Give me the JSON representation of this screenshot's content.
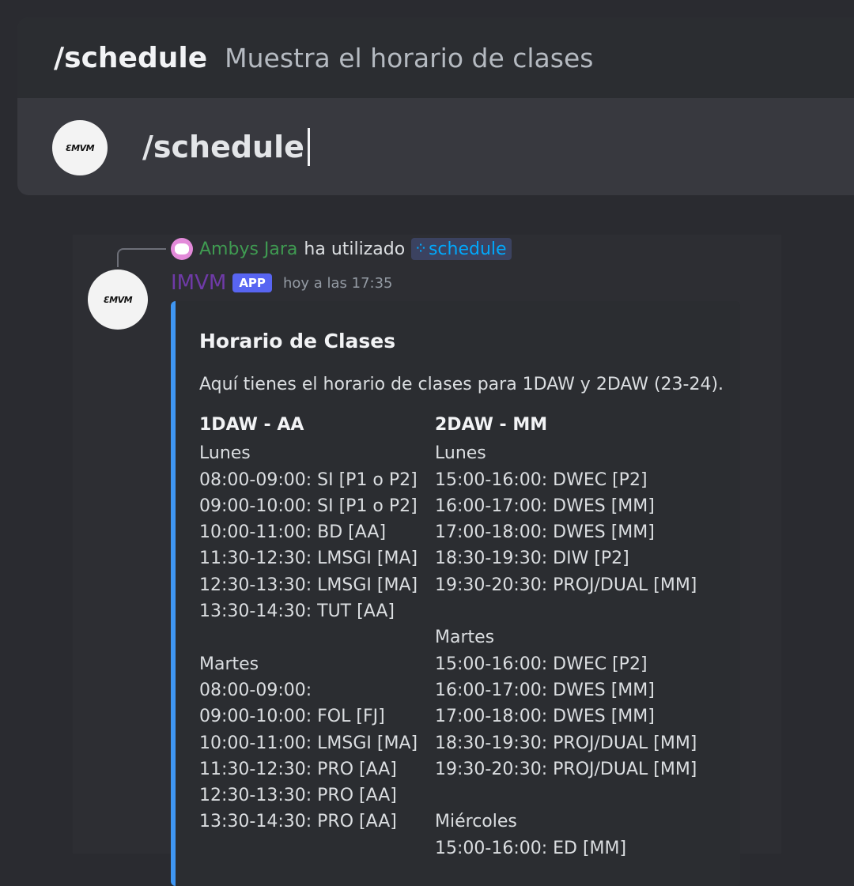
{
  "command_bar": {
    "command": "/schedule",
    "description": "Muestra el horario de clases",
    "input_value": "/schedule",
    "logo_text": "ƐMVM"
  },
  "reply": {
    "user": "Ambys Jara",
    "verb": "ha utilizado",
    "command_icon": "slash-command-icon",
    "command": "schedule"
  },
  "message": {
    "author": "IMVM",
    "badge": "APP",
    "timestamp": "hoy a las 17:35",
    "logo_text": "ƐMVM"
  },
  "embed": {
    "accent": "#3f96f2",
    "title": "Horario de Clases",
    "description": "Aquí tienes el horario de clases para 1DAW y 2DAW (23-24).",
    "fields": [
      {
        "name": "1DAW - AA",
        "lines": [
          "Lunes",
          "08:00-09:00: SI [P1 o P2]",
          "09:00-10:00: SI [P1 o P2]",
          "10:00-11:00: BD [AA]",
          "11:30-12:30: LMSGI [MA]",
          "12:30-13:30: LMSGI [MA]",
          "13:30-14:30: TUT [AA]",
          "",
          "Martes",
          "08:00-09:00:",
          "09:00-10:00: FOL [FJ]",
          "10:00-11:00: LMSGI [MA]",
          "11:30-12:30: PRO [AA]",
          "12:30-13:30: PRO [AA]",
          "13:30-14:30: PRO [AA]"
        ]
      },
      {
        "name": "2DAW - MM",
        "lines": [
          "Lunes",
          "15:00-16:00: DWEC [P2]",
          "16:00-17:00: DWES [MM]",
          "17:00-18:00: DWES [MM]",
          "18:30-19:30: DIW [P2]",
          "19:30-20:30: PROJ/DUAL [MM]",
          "",
          "Martes",
          "15:00-16:00: DWEC [P2]",
          "16:00-17:00: DWES [MM]",
          "17:00-18:00: DWES [MM]",
          "18:30-19:30: PROJ/DUAL [MM]",
          "19:30-20:30: PROJ/DUAL [MM]",
          "",
          "Miércoles",
          "15:00-16:00: ED [MM]"
        ]
      }
    ]
  }
}
